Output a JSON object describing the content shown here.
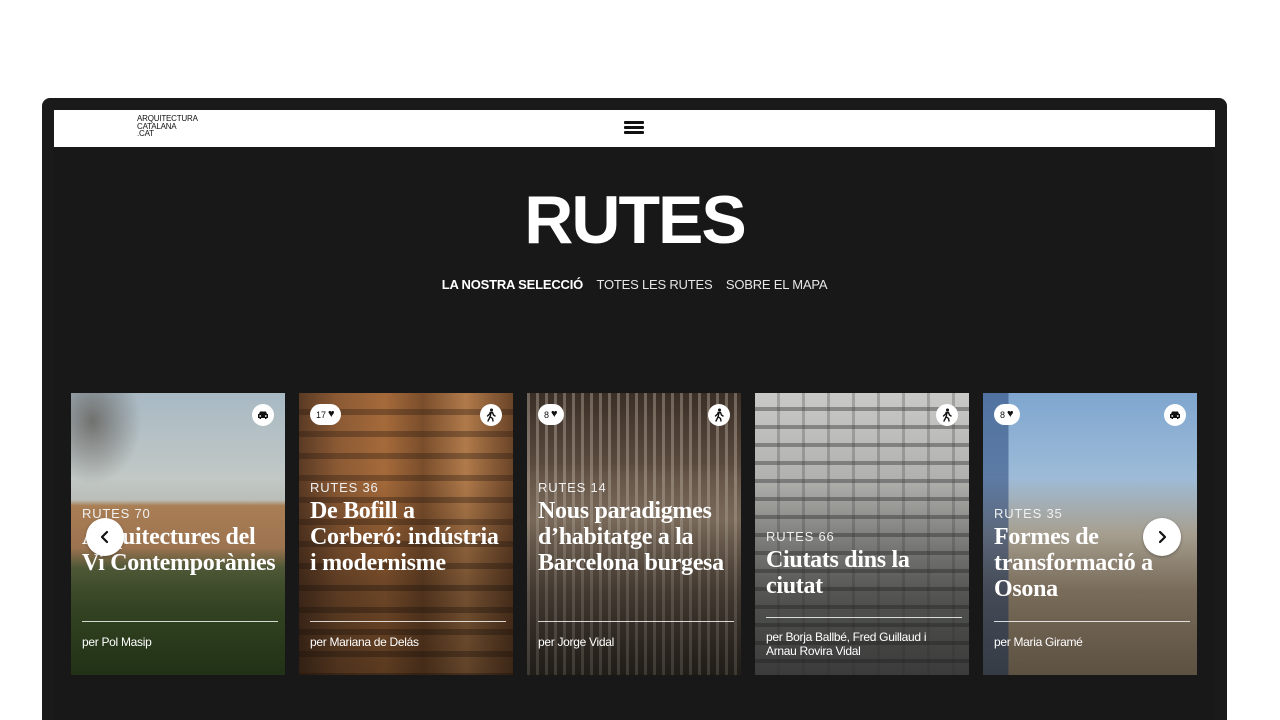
{
  "header": {
    "logo_lines": [
      "ARQUITECTURA",
      "CATALANA",
      ".CAT"
    ],
    "menu_icon": "hamburger-menu-icon"
  },
  "page": {
    "title": "RUTES",
    "subnav": [
      {
        "label": "LA NOSTRA SELECCIÓ",
        "active": true
      },
      {
        "label": "TOTES LES RUTES",
        "active": false
      },
      {
        "label": "SOBRE EL MAPA",
        "active": false
      }
    ]
  },
  "routes": [
    {
      "number": "RUTES 70",
      "title": "Arquitectures del Vi Contemporànies",
      "author": "per Pol Masip",
      "likes": "",
      "mode": "car-icon"
    },
    {
      "number": "RUTES 36",
      "title": "De Bofill a Corberó: indústria i modernisme",
      "author": "per Mariana de Delás",
      "likes": "17",
      "mode": "walking-icon"
    },
    {
      "number": "RUTES 14",
      "title": "Nous paradigmes d’habitatge a la Barcelona burgesa",
      "author": "per Jorge Vidal",
      "likes": "8",
      "mode": "walking-icon"
    },
    {
      "number": "RUTES 66",
      "title": "Ciutats dins la ciutat",
      "author": "per Borja Ballbé, Fred Guillaud i Arnau Rovira Vidal",
      "likes": "",
      "mode": "walking-icon"
    },
    {
      "number": "RUTES 35",
      "title": "Formes de transformació a Osona",
      "author": "per Maria Giramé",
      "likes": "8",
      "mode": "car-icon"
    }
  ],
  "carousel": {
    "prev_icon": "chevron-left-icon",
    "next_icon": "chevron-right-icon"
  },
  "colors": {
    "background": "#181818",
    "text": "#ffffff",
    "topbar": "#ffffff"
  }
}
